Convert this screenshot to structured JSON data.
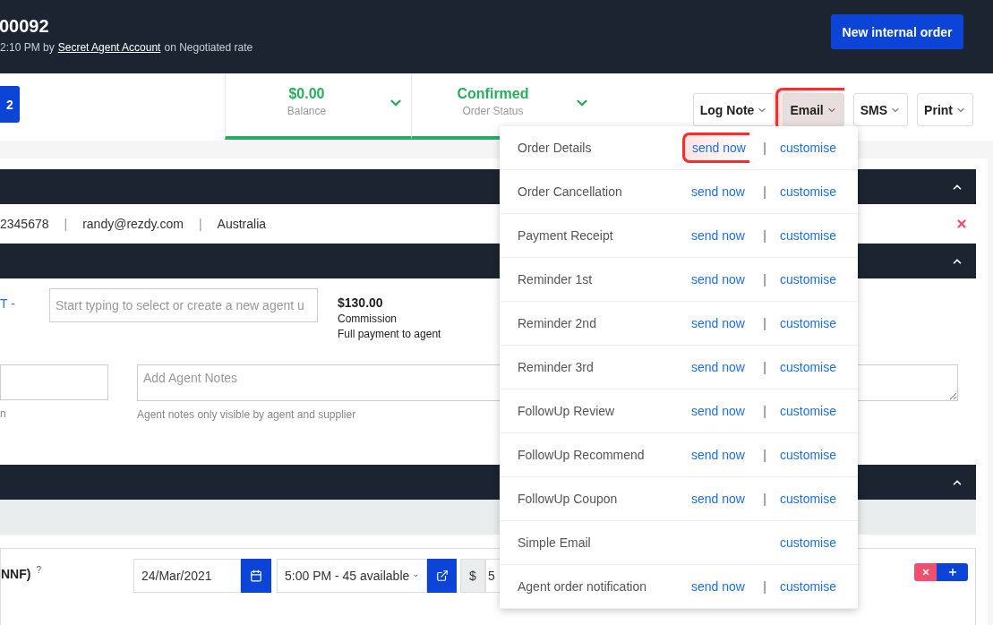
{
  "header": {
    "title": "00092",
    "subtitle_before": "2:10 PM by",
    "agent_link": "Secret Agent Account",
    "subtitle_after": "on Negotiated rate",
    "new_order_button": "New internal order"
  },
  "toolbar": {
    "left_button": "2",
    "stats": [
      {
        "value": "$0.00",
        "label": "Balance"
      },
      {
        "value": "Confirmed",
        "label": "Order Status"
      }
    ],
    "actions": [
      {
        "label": "Log Note",
        "open": false,
        "highlighted": false
      },
      {
        "label": "Email",
        "open": true,
        "highlighted": true
      },
      {
        "label": "SMS",
        "open": false,
        "highlighted": false
      },
      {
        "label": "Print",
        "open": false,
        "highlighted": false
      }
    ]
  },
  "section_bars": [
    {
      "expanded": true
    },
    {
      "expanded": true
    },
    {
      "expanded": true
    }
  ],
  "contact": {
    "items": [
      "2345678",
      "randy@rezdy.com",
      "Australia"
    ],
    "separators": [
      "|",
      "|"
    ]
  },
  "agent": {
    "link": "T -",
    "search_placeholder": "Start typing to select or create a new agent u",
    "commission_amount": "$130.00",
    "commission_label": "Commission",
    "payment_note": "Full payment to agent"
  },
  "notes": {
    "field_hint": "n",
    "agent_notes_placeholder": "Add Agent Notes",
    "agent_notes_hint": "Agent notes only visible by agent and supplier"
  },
  "product": {
    "name": "NNF)",
    "help": "?",
    "date": "24/Mar/2021",
    "session": "5:00 PM - 45 available",
    "currency": "$",
    "price": "5"
  },
  "email_menu": {
    "items": [
      {
        "label": "Order Details",
        "send_now": "send now",
        "separator": "|",
        "customise": "customise",
        "highlighted": true
      },
      {
        "label": "Order Cancellation",
        "send_now": "send now",
        "separator": "|",
        "customise": "customise",
        "highlighted": false
      },
      {
        "label": "Payment Receipt",
        "send_now": "send now",
        "separator": "|",
        "customise": "customise",
        "highlighted": false
      },
      {
        "label": "Reminder 1st",
        "send_now": "send now",
        "separator": "|",
        "customise": "customise",
        "highlighted": false
      },
      {
        "label": "Reminder 2nd",
        "send_now": "send now",
        "separator": "|",
        "customise": "customise",
        "highlighted": false
      },
      {
        "label": "Reminder 3rd",
        "send_now": "send now",
        "separator": "|",
        "customise": "customise",
        "highlighted": false
      },
      {
        "label": "FollowUp Review",
        "send_now": "send now",
        "separator": "|",
        "customise": "customise",
        "highlighted": false
      },
      {
        "label": "FollowUp Recommend",
        "send_now": "send now",
        "separator": "|",
        "customise": "customise",
        "highlighted": false
      },
      {
        "label": "FollowUp Coupon",
        "send_now": "send now",
        "separator": "|",
        "customise": "customise",
        "highlighted": false
      },
      {
        "label": "Simple Email",
        "customise": "customise",
        "highlighted": false
      },
      {
        "label": "Agent order notification",
        "send_now": "send now",
        "separator": "|",
        "customise": "customise",
        "highlighted": false
      }
    ]
  }
}
